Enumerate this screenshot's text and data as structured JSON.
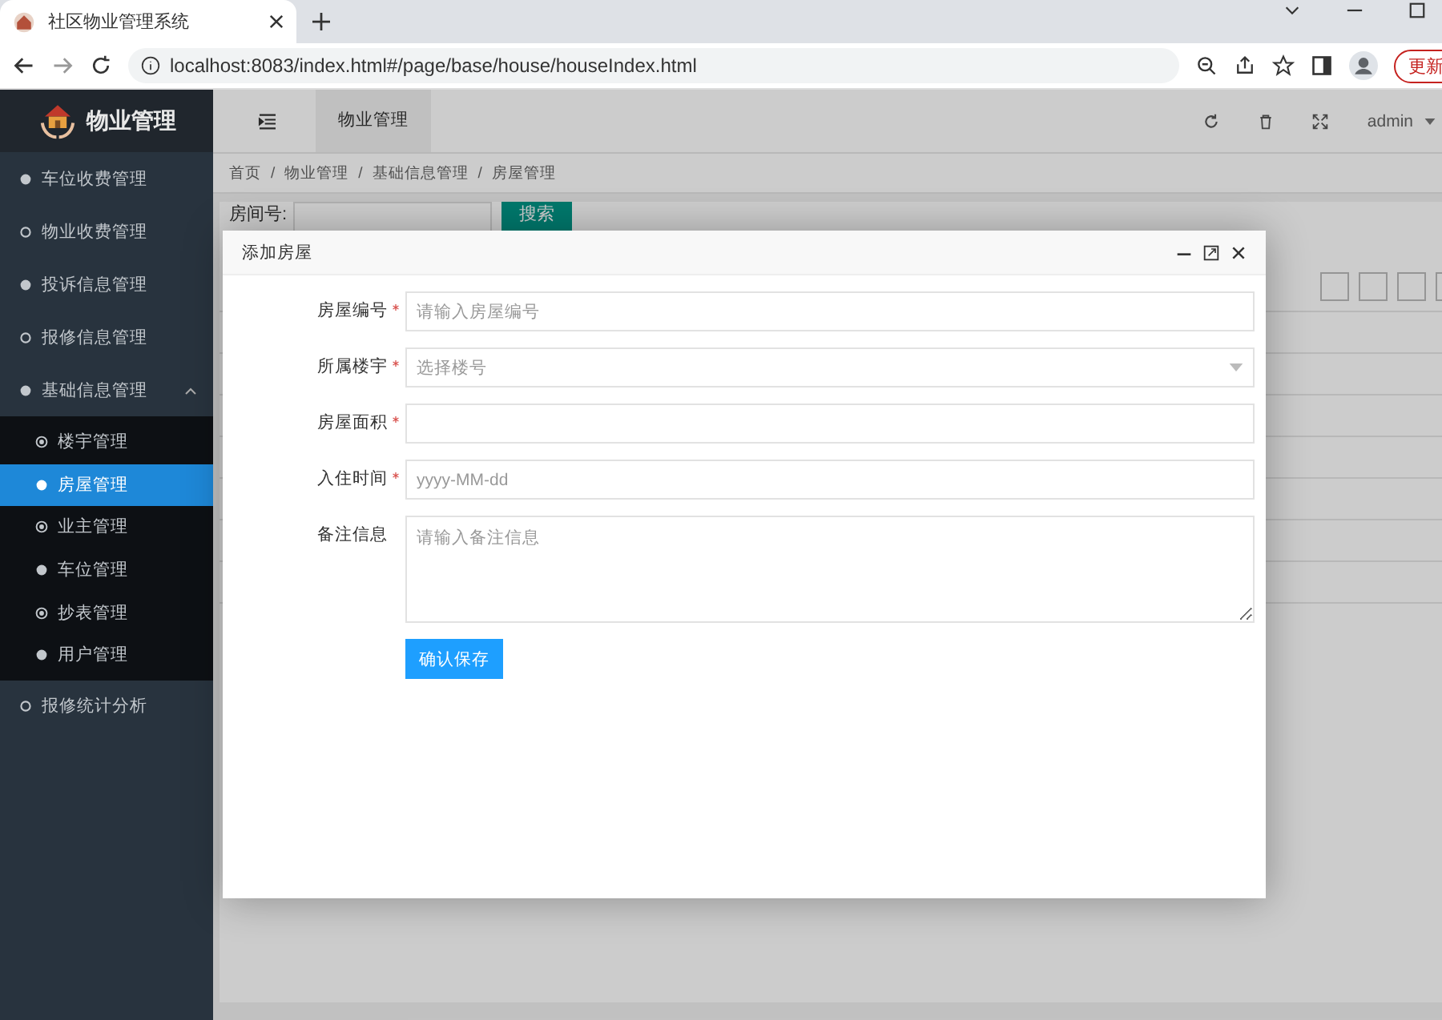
{
  "browser": {
    "tab_title": "社区物业管理系统",
    "url": "localhost:8083/index.html#/page/base/house/houseIndex.html",
    "update_button": "更新"
  },
  "app": {
    "logo_text": "物业管理",
    "header_tab": "物业管理",
    "user": "admin"
  },
  "sidebar": {
    "items": [
      {
        "label": "车位收费管理",
        "selected": false
      },
      {
        "label": "物业收费管理",
        "selected": false
      },
      {
        "label": "投诉信息管理",
        "selected": false
      },
      {
        "label": "报修信息管理",
        "selected": false
      },
      {
        "label": "基础信息管理",
        "selected": false,
        "expanded": true,
        "children": [
          {
            "label": "楼宇管理",
            "selected": false
          },
          {
            "label": "房屋管理",
            "selected": true
          },
          {
            "label": "业主管理",
            "selected": false
          },
          {
            "label": "车位管理",
            "selected": false
          },
          {
            "label": "抄表管理",
            "selected": false
          },
          {
            "label": "用户管理",
            "selected": false
          }
        ]
      },
      {
        "label": "报修统计分析",
        "selected": false
      }
    ]
  },
  "breadcrumb": {
    "separator": "/",
    "items": [
      "首页",
      "物业管理",
      "基础信息管理",
      "房屋管理"
    ]
  },
  "search": {
    "label": "房间号:",
    "button": "搜索"
  },
  "dialog": {
    "title": "添加房屋",
    "fields": [
      {
        "label": "房屋编号",
        "required": true,
        "kind": "text",
        "placeholder": "请输入房屋编号"
      },
      {
        "label": "所属楼宇",
        "required": true,
        "kind": "select",
        "placeholder": "选择楼号"
      },
      {
        "label": "房屋面积",
        "required": true,
        "kind": "text"
      },
      {
        "label": "入住时间",
        "required": true,
        "kind": "text",
        "placeholder": "yyyy-MM-dd"
      },
      {
        "label": "备注信息",
        "required": false,
        "kind": "textarea",
        "placeholder": "请输入备注信息"
      }
    ],
    "submit": "确认保存"
  }
}
